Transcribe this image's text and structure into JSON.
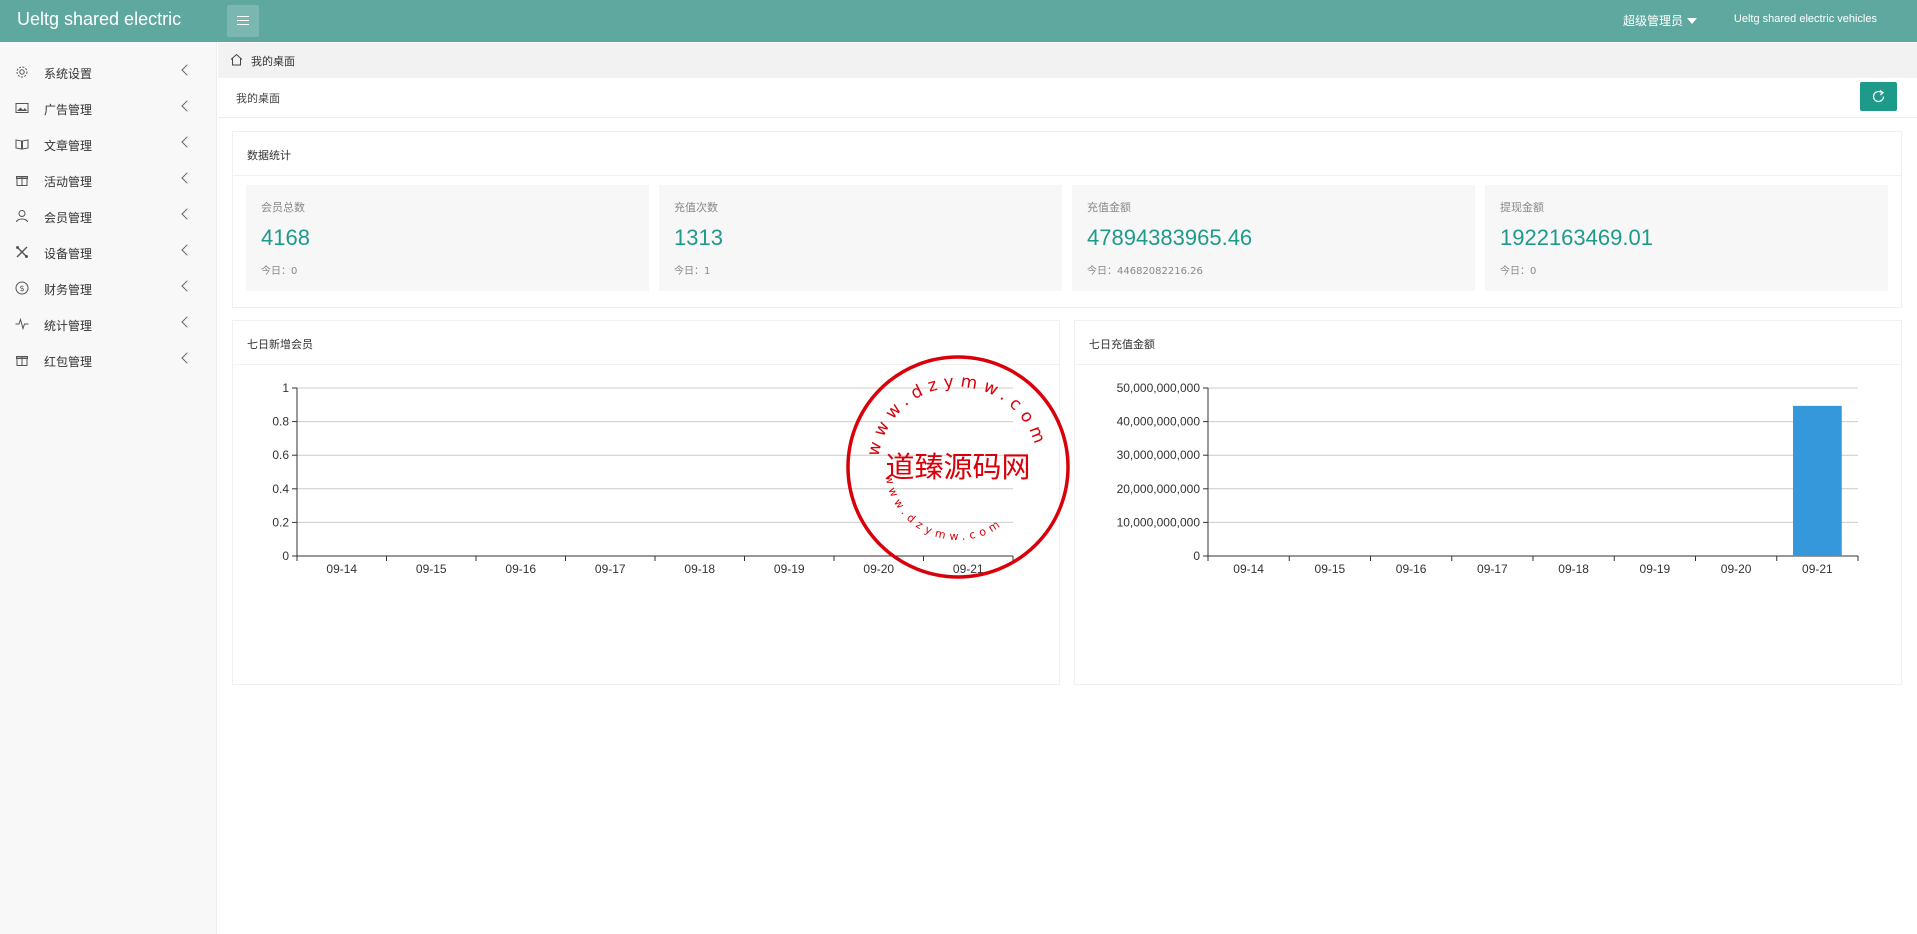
{
  "header": {
    "brand": "Ueltg shared electric",
    "user": "超级管理员",
    "app_name": "Ueltg shared electric vehicles"
  },
  "sidebar": {
    "items": [
      {
        "label": "系统设置",
        "icon": "gear-icon"
      },
      {
        "label": "广告管理",
        "icon": "image-icon"
      },
      {
        "label": "文章管理",
        "icon": "book-icon"
      },
      {
        "label": "活动管理",
        "icon": "gift-icon"
      },
      {
        "label": "会员管理",
        "icon": "user-icon"
      },
      {
        "label": "设备管理",
        "icon": "tools-icon"
      },
      {
        "label": "财务管理",
        "icon": "dollar-icon"
      },
      {
        "label": "统计管理",
        "icon": "pulse-icon"
      },
      {
        "label": "红包管理",
        "icon": "redpacket-icon"
      }
    ]
  },
  "breadcrumb": {
    "label": "我的桌面"
  },
  "page": {
    "title": "我的桌面"
  },
  "stats_card": {
    "title": "数据统计",
    "items": [
      {
        "label": "会员总数",
        "value": "4168",
        "today_label": "今日：",
        "today_value": "0"
      },
      {
        "label": "充值次数",
        "value": "1313",
        "today_label": "今日：",
        "today_value": "1"
      },
      {
        "label": "充值金额",
        "value": "47894383965.46",
        "today_label": "今日：",
        "today_value": "44682082216.26"
      },
      {
        "label": "提现金额",
        "value": "1922163469.01",
        "today_label": "今日：",
        "today_value": "0"
      }
    ]
  },
  "chart_data": [
    {
      "type": "line",
      "title": "七日新增会员",
      "categories": [
        "09-14",
        "09-15",
        "09-16",
        "09-17",
        "09-18",
        "09-19",
        "09-20",
        "09-21"
      ],
      "values": [
        0,
        0,
        0,
        0,
        0,
        0,
        0,
        0
      ],
      "ylim": [
        0,
        1
      ],
      "yticks": [
        "0",
        "0.2",
        "0.4",
        "0.6",
        "0.8",
        "1"
      ],
      "grid": true
    },
    {
      "type": "bar",
      "title": "七日充值金额",
      "categories": [
        "09-14",
        "09-15",
        "09-16",
        "09-17",
        "09-18",
        "09-19",
        "09-20",
        "09-21"
      ],
      "values": [
        0,
        0,
        0,
        0,
        0,
        0,
        0,
        44682082216.26
      ],
      "ylim": [
        0,
        50000000000
      ],
      "yticks": [
        "0",
        "10,000,000,000",
        "20,000,000,000",
        "30,000,000,000",
        "40,000,000,000",
        "50,000,000,000"
      ],
      "bar_color": "#3498db",
      "grid": true
    }
  ],
  "watermark": {
    "text": "道臻源码网",
    "url": "www.dzymw.com",
    "color": "#d9000a"
  }
}
